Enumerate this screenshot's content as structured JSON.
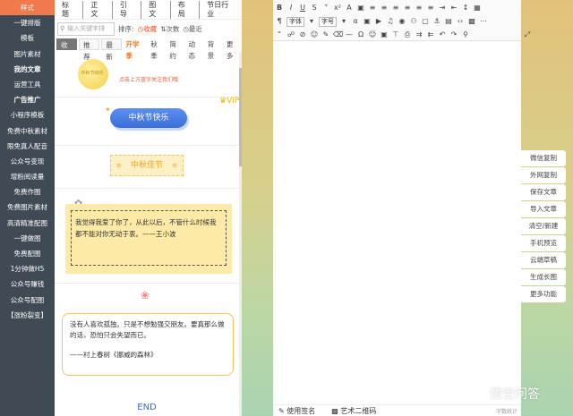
{
  "sidebar": {
    "items": [
      {
        "label": "样式"
      },
      {
        "label": "一键排版"
      },
      {
        "label": "模板"
      },
      {
        "label": "图片素材"
      },
      {
        "label": "我的文章"
      },
      {
        "label": "运营工具"
      },
      {
        "label": "广告推广"
      },
      {
        "label": "小程序模板"
      },
      {
        "label": "免费中秋素材"
      },
      {
        "label": "限免真人配音"
      },
      {
        "label": "公众号变现"
      },
      {
        "label": "增粉阅读量"
      },
      {
        "label": "免费作图"
      },
      {
        "label": "免费图片素材"
      },
      {
        "label": "高清精准配图"
      },
      {
        "label": "一键做图"
      },
      {
        "label": "免费配图"
      },
      {
        "label": "1分钟做H5"
      },
      {
        "label": "公众号赚钱"
      },
      {
        "label": "公众号配图"
      },
      {
        "label": "【涨粉裂变】"
      }
    ]
  },
  "panel": {
    "nav": [
      "标题",
      "正文",
      "引导",
      "图文",
      "布局",
      "节日行业"
    ],
    "search_placeholder": "输入关键字排",
    "sort_label": "排序:",
    "sort_options": [
      "收藏",
      "次数",
      "最近"
    ],
    "tabs": [
      "收藏",
      "推荐",
      "最新",
      "开学季",
      "秋季",
      "简约",
      "动态",
      "背景",
      "更多"
    ],
    "moon_text": "中秋节快乐",
    "moon_tip": "点击上方蓝字关注我们哦",
    "pill_text": "中秋节快乐",
    "vip": "VIP",
    "tag_text": "中秋佳节",
    "quote1": "我觉得我爱了你了，从此以后，不管什么时候我都不能对你无动于衷。——王小波",
    "quote2": "没有人喜欢孤独。只是不想勉强交朋友。要真那么做的话，恐怕只会失望而已。",
    "quote2_sign": "——村上春树《挪威的森林》",
    "end": "END"
  },
  "editor": {
    "font_label": "字体",
    "size_label": "字号",
    "footer": {
      "sign": "使用签名",
      "qrcode": "艺术二维码",
      "count": "字数统计"
    }
  },
  "actions": [
    "微信复制",
    "外网复制",
    "保存文章",
    "导入文章",
    "清空/新建",
    "手机预览",
    "云端草稿",
    "生成长图",
    "更多功能"
  ],
  "watermark": "悟空问答"
}
